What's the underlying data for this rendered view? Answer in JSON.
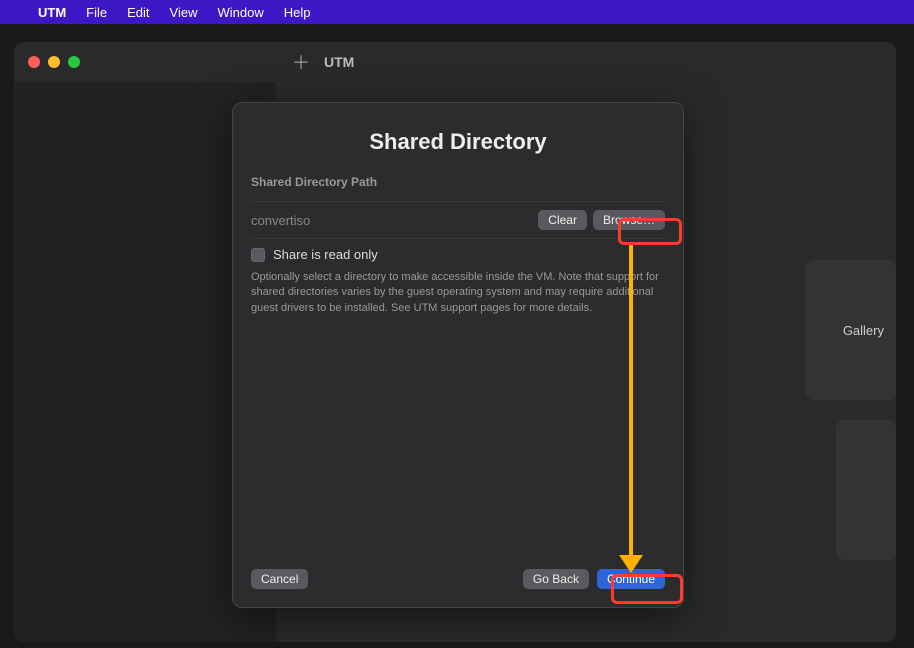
{
  "menubar": {
    "app": "UTM",
    "items": [
      "File",
      "Edit",
      "View",
      "Window",
      "Help"
    ]
  },
  "window": {
    "title": "UTM"
  },
  "gallery": {
    "label": "Gallery"
  },
  "sheet": {
    "title": "Shared Directory",
    "section_label": "Shared Directory Path",
    "path_value": "convertiso",
    "clear_label": "Clear",
    "browse_label": "Browse…",
    "readonly_label": "Share is read only",
    "description": "Optionally select a directory to make accessible inside the VM. Note that support for shared directories varies by the guest operating system and may require additional guest drivers to be installed. See UTM support pages for more details.",
    "cancel_label": "Cancel",
    "goback_label": "Go Back",
    "continue_label": "Continue"
  }
}
